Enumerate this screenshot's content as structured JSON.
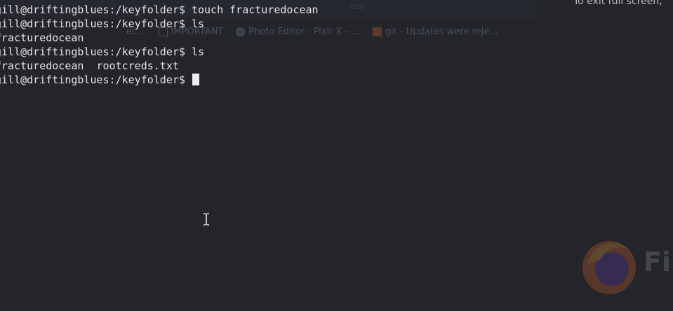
{
  "overlay": {
    "fullscreen_notice": "To exit full screen,",
    "ghost_tabs": [
      "ec...",
      "IMPORTANT",
      "Photo Editor : Pixlr X - ...",
      "git - Updates were reje..."
    ],
    "ghost_url_text": "ess",
    "watermark_text": "Fi",
    "watermark_icon": "firefox-logo-icon"
  },
  "terminal": {
    "lines": [
      {
        "prompt": "gill@driftingblues:/keyfolder$",
        "command": " touch fracturedocean"
      },
      {
        "prompt": "gill@driftingblues:/keyfolder$",
        "command": " ls"
      },
      {
        "prompt": "",
        "command": "fracturedocean"
      },
      {
        "prompt": "gill@driftingblues:/keyfolder$",
        "command": " ls"
      },
      {
        "prompt": "",
        "command": "fracturedocean  rootcreds.txt"
      },
      {
        "prompt": "gill@driftingblues:/keyfolder$",
        "command": " "
      }
    ]
  },
  "colors": {
    "background": "#23252b",
    "text": "#e3e4e6",
    "cursor": "#ededed"
  },
  "pointer": "text-cursor-icon"
}
